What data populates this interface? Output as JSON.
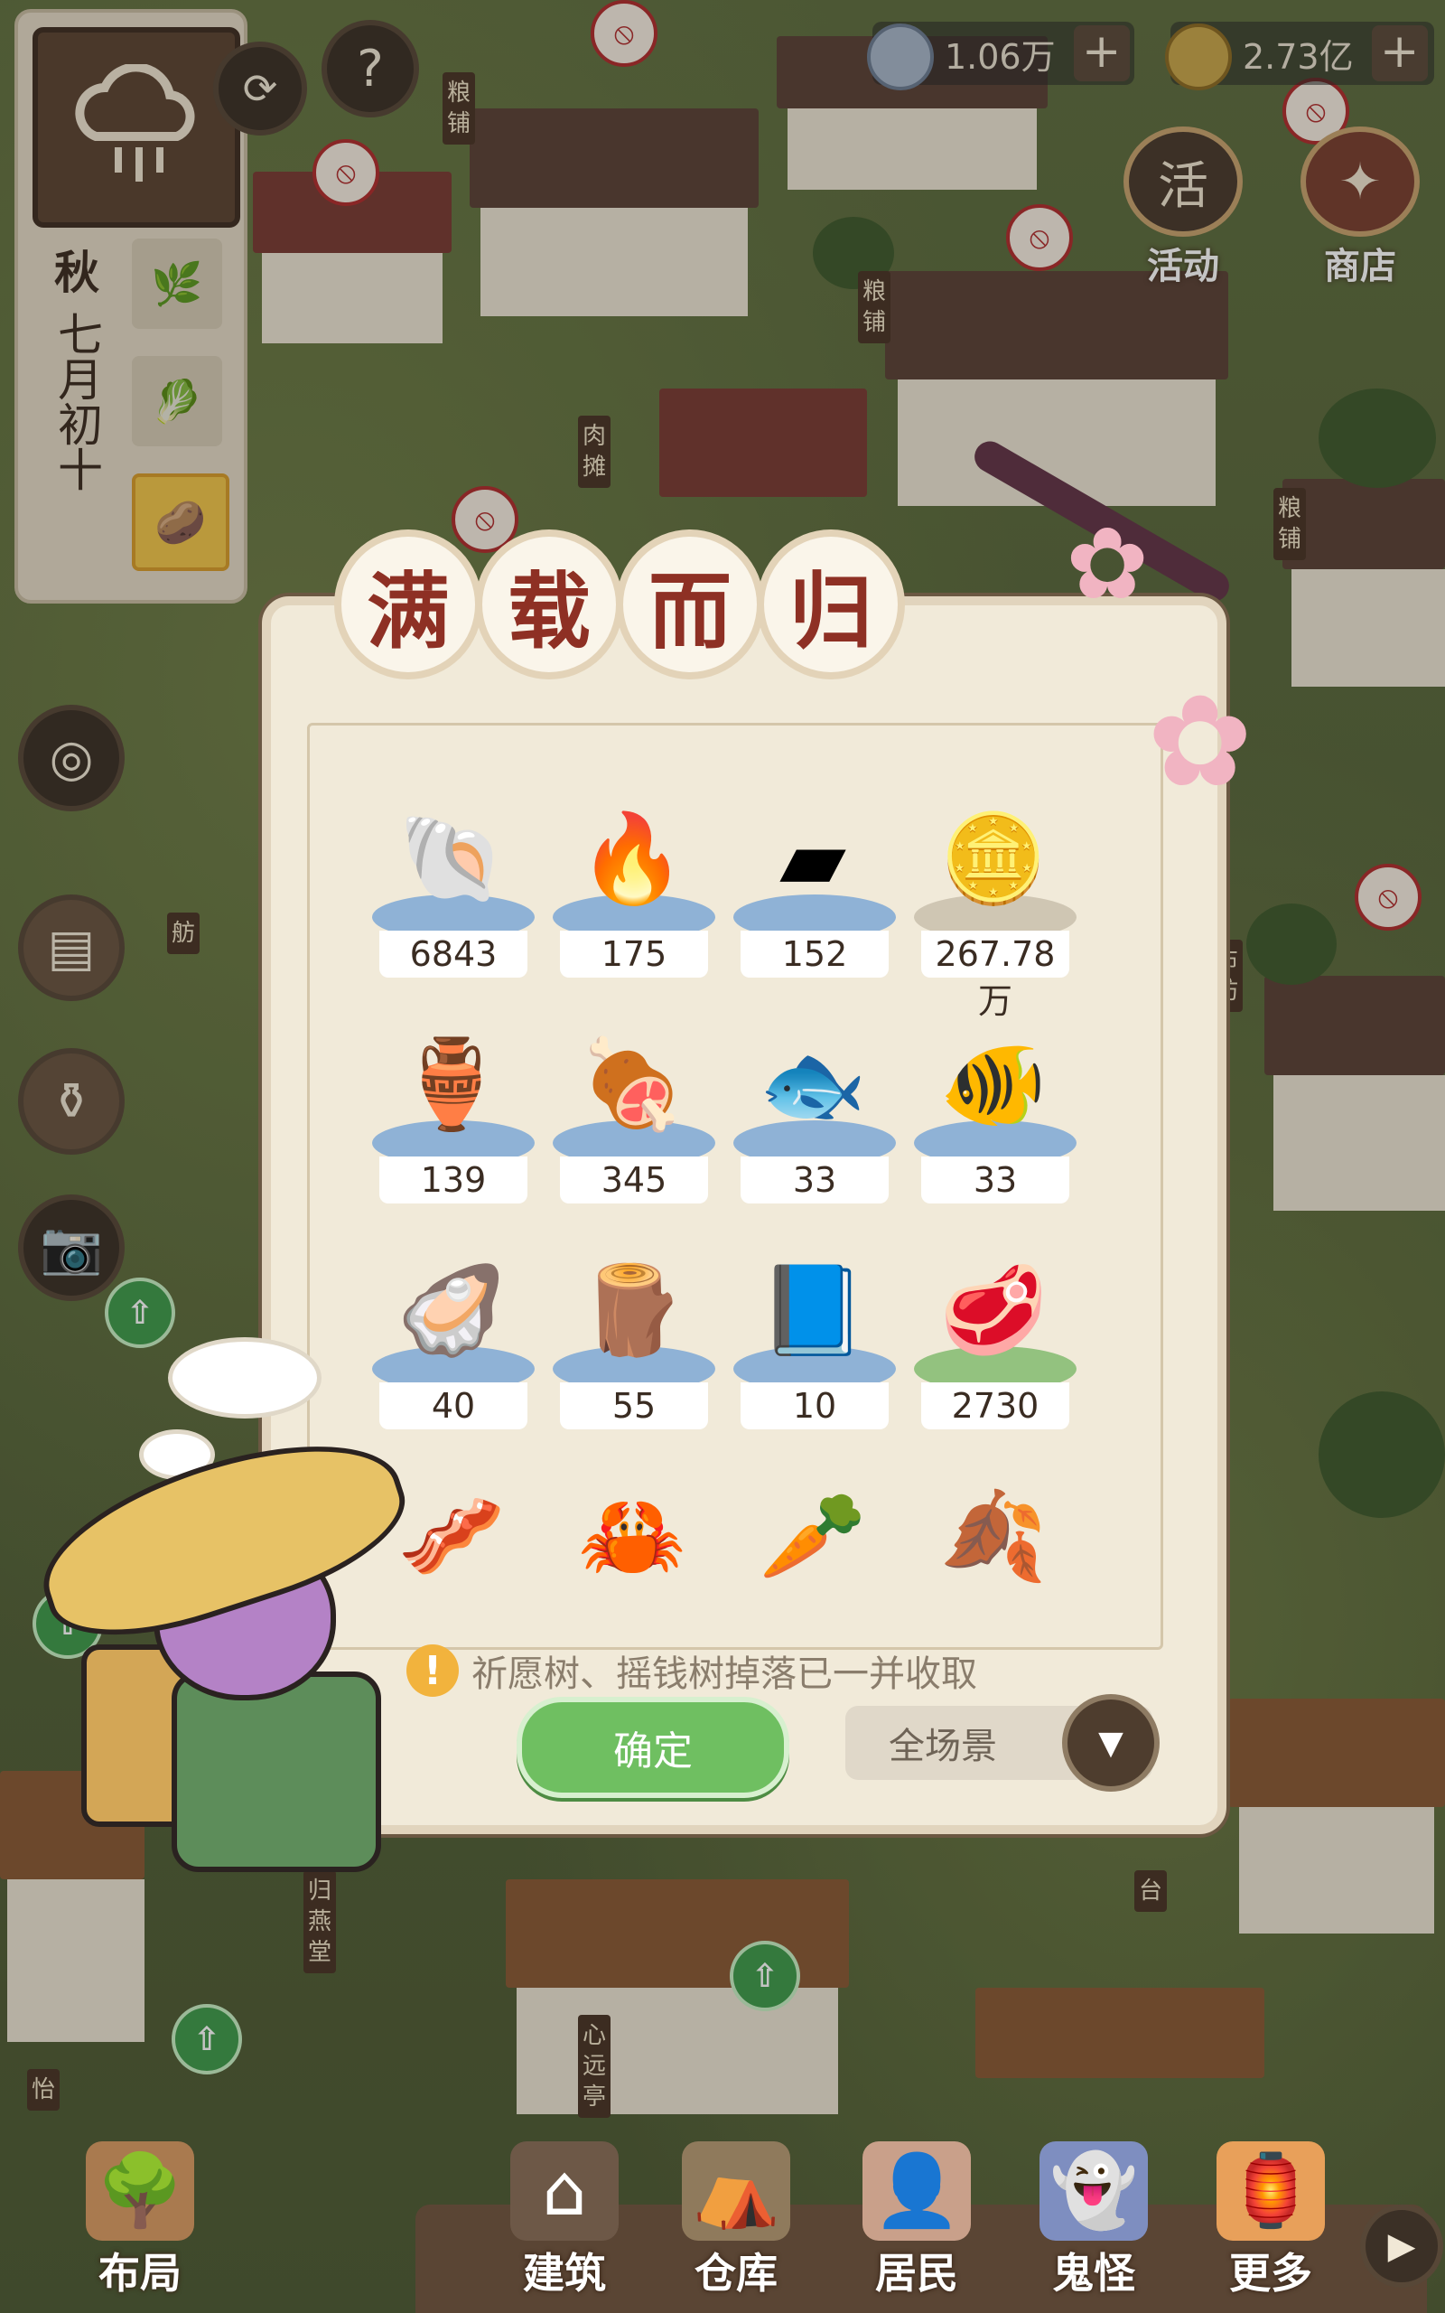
{
  "resources": [
    {
      "name": "silver-ingot",
      "value": "1.06万"
    },
    {
      "name": "copper-coin",
      "value": "2.73亿"
    }
  ],
  "calendar": {
    "season": "秋",
    "date": "七月初十"
  },
  "top_buttons": {
    "activity": "活动",
    "shop": "商店"
  },
  "signs": [
    "粮铺",
    "粮铺",
    "肉摊",
    "粮铺",
    "舫",
    "布坊",
    "归燕堂",
    "心远亭",
    "台",
    "怡"
  ],
  "dialog": {
    "title": [
      "满",
      "载",
      "而",
      "归"
    ],
    "items": [
      {
        "icon": "shell-icon",
        "count": "6843"
      },
      {
        "icon": "flame-icon",
        "count": "175"
      },
      {
        "icon": "gold-paper-icon",
        "count": "152"
      },
      {
        "icon": "copper-coin-icon",
        "count": "267.78万"
      },
      {
        "icon": "wine-jar-icon",
        "count": "139"
      },
      {
        "icon": "ham-icon",
        "count": "345"
      },
      {
        "icon": "fish-icon",
        "count": "33"
      },
      {
        "icon": "carp-icon",
        "count": "33"
      },
      {
        "icon": "clam-icon",
        "count": "40"
      },
      {
        "icon": "log-icon",
        "count": "55"
      },
      {
        "icon": "book-icon",
        "count": "10"
      },
      {
        "icon": "beef-icon",
        "count": "2730"
      },
      {
        "icon": "pork-icon",
        "count": ""
      },
      {
        "icon": "crab-icon",
        "count": ""
      },
      {
        "icon": "root-icon",
        "count": ""
      },
      {
        "icon": "tea-leaves-icon",
        "count": ""
      }
    ],
    "notice": "祈愿树、摇钱树掉落已一并收取",
    "confirm": "确定",
    "scope": "全场景"
  },
  "nav": [
    {
      "label": "布局",
      "icon": "layout-icon"
    },
    {
      "label": "建筑",
      "icon": "building-icon"
    },
    {
      "label": "仓库",
      "icon": "warehouse-icon"
    },
    {
      "label": "居民",
      "icon": "resident-icon"
    },
    {
      "label": "鬼怪",
      "icon": "ghost-icon"
    },
    {
      "label": "更多",
      "icon": "more-icon"
    }
  ],
  "colors": {
    "title": "#8e3024",
    "confirm": "#6fbf61",
    "panel": "#f1ead9"
  }
}
